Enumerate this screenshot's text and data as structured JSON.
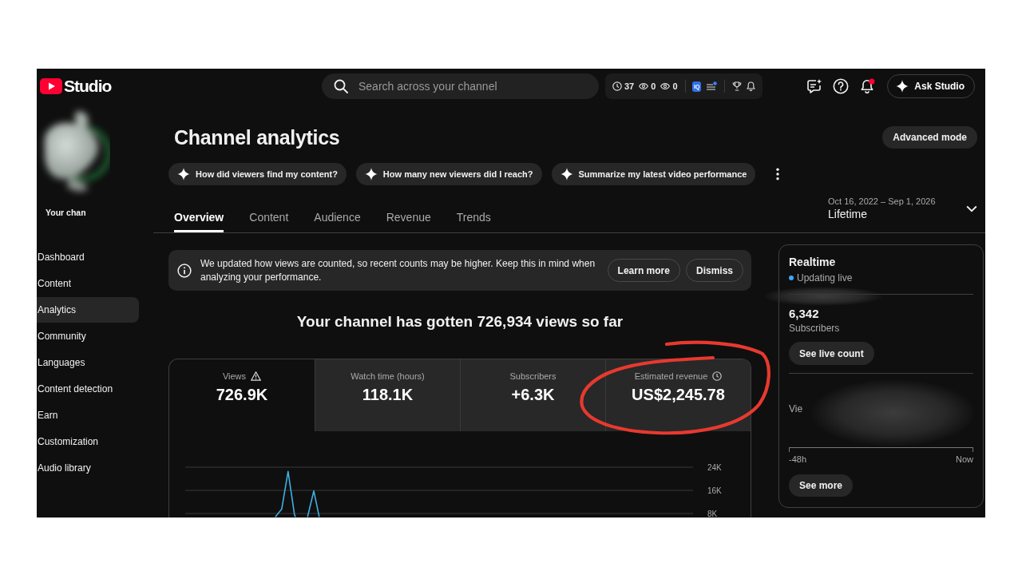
{
  "topbar": {
    "app_name": "Studio",
    "search": {
      "placeholder": "Search across your channel"
    },
    "extension_stats": [
      {
        "kind": "clock",
        "value": "37"
      },
      {
        "kind": "eye",
        "value": "0"
      },
      {
        "kind": "eye",
        "value": "0"
      }
    ],
    "extension_badge": "IQ",
    "extension_alert": true,
    "notifications_unread": true,
    "ask_button": "Ask Studio"
  },
  "sidebar": {
    "avatar": {
      "redacted": true
    },
    "channel_label": "Your chan",
    "items": [
      {
        "label": "Dashboard",
        "selected": false
      },
      {
        "label": "Content",
        "selected": false
      },
      {
        "label": "Analytics",
        "selected": true
      },
      {
        "label": "Community",
        "selected": false
      },
      {
        "label": "Languages",
        "selected": false
      },
      {
        "label": "Content detection",
        "selected": false
      },
      {
        "label": "Earn",
        "selected": false
      },
      {
        "label": "Customization",
        "selected": false
      },
      {
        "label": "Audio library",
        "selected": false
      }
    ]
  },
  "header": {
    "title": "Channel analytics",
    "advanced_button": "Advanced mode",
    "suggestions": [
      "How did viewers find my content?",
      "How many new viewers did I reach?",
      "Summarize my latest video performance"
    ],
    "tabs": [
      {
        "label": "Overview",
        "selected": true
      },
      {
        "label": "Content",
        "selected": false
      },
      {
        "label": "Audience",
        "selected": false
      },
      {
        "label": "Revenue",
        "selected": false
      },
      {
        "label": "Trends",
        "selected": false
      }
    ],
    "date_range": {
      "range": "Oct 16, 2022 – Sep 1, 2026",
      "period": "Lifetime"
    }
  },
  "notice": {
    "text": "We updated how views are counted, so recent counts may be higher. Keep this in mind when analyzing your performance.",
    "buttons": [
      "Learn more",
      "Dismiss"
    ]
  },
  "overview": {
    "headline": "Your channel has gotten 726,934 views so far",
    "metrics": [
      {
        "kind": "alert",
        "label": "Views",
        "value": "726.9K",
        "selected": true,
        "circled": false
      },
      {
        "kind": "plain",
        "label": "Watch time (hours)",
        "value": "118.1K",
        "selected": false,
        "circled": false
      },
      {
        "kind": "plain",
        "label": "Subscribers",
        "value": "+6.3K",
        "selected": false,
        "circled": false
      },
      {
        "kind": "delayed",
        "label": "Estimated revenue",
        "value": "US$2,245.78",
        "selected": false,
        "circled": true
      }
    ],
    "chart": {
      "y_labels": [
        "24K",
        "16K",
        "8K"
      ]
    }
  },
  "realtime": {
    "title": "Realtime",
    "status": "Updating live",
    "count": "6,342",
    "count_label": "Subscribers",
    "live_button": "See live count",
    "views_label": "Vie",
    "x_start": "-48h",
    "x_end": "Now",
    "more_button": "See more",
    "redacted": true
  }
}
